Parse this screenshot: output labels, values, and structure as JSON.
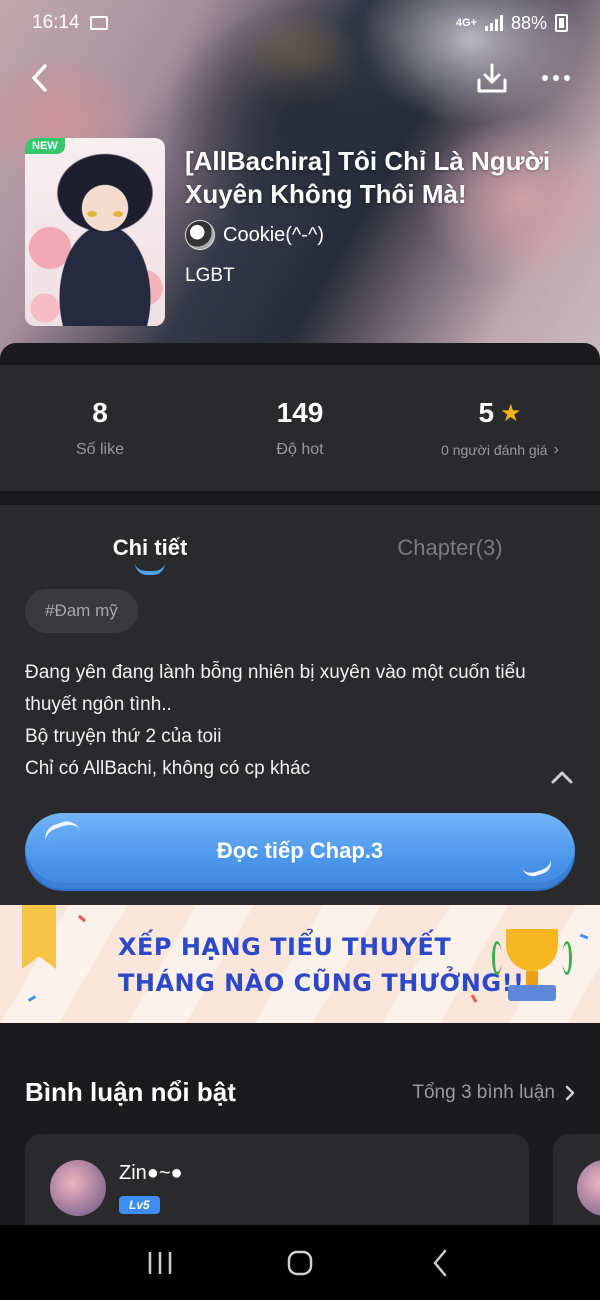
{
  "status": {
    "time": "16:14",
    "network": "4G+",
    "battery": "88%"
  },
  "book": {
    "badge": "NEW",
    "title": "[AllBachira] Tôi Chỉ Là Người Xuyên Không Thôi Mà!",
    "author": "Cookie(^-^)",
    "genre": "LGBT"
  },
  "stats": [
    {
      "value": "8",
      "label": "Số like"
    },
    {
      "value": "149",
      "label": "Độ hot"
    },
    {
      "value": "5",
      "label": "0 người đánh giá"
    }
  ],
  "tabs": [
    {
      "label": "Chi tiết",
      "active": true
    },
    {
      "label": "Chapter(3)",
      "active": false
    }
  ],
  "tag": "#Đam mỹ",
  "description": [
    "Đang yên đang lành bỗng nhiên bị xuyên vào một cuốn tiểu thuyết ngôn tình..",
    "Bộ truyện thứ 2 của toii",
    "Chỉ có AllBachi, không có cp khác"
  ],
  "read_button": "Đọc tiếp Chap.3",
  "banner": {
    "line1": "XẾP HẠNG TIỂU THUYẾT",
    "line2": "THÁNG NÀO CŨNG THƯỞNG!!"
  },
  "comments": {
    "title": "Bình luận nổi bật",
    "total": "Tổng 3 bình luận",
    "items": [
      {
        "name": "Zin●~●",
        "level": "Lv5"
      }
    ]
  },
  "colors": {
    "accent": "#4b97ec",
    "star": "#f5b21b",
    "background": "#1b1b1d",
    "panel": "#2a2a2c"
  }
}
